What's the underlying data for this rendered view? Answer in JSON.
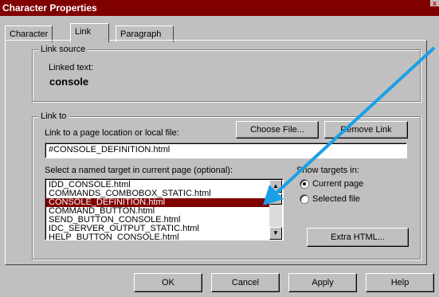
{
  "window": {
    "title": "Character Properties",
    "close_glyph": "x"
  },
  "tabs": [
    {
      "label": "Character"
    },
    {
      "label": "Link"
    },
    {
      "label": "Paragraph"
    }
  ],
  "link_source": {
    "group_label": "Link source",
    "linked_text_label": "Linked text:",
    "linked_text_value": "console"
  },
  "link_to": {
    "group_label": "Link to",
    "location_label": "Link to a page location or local file:",
    "location_value": "#CONSOLE_DEFINITION.html",
    "choose_file": "Choose File...",
    "remove_link": "Remove Link",
    "targets_label": "Select a named target in current page (optional):",
    "targets": [
      "IDD_CONSOLE.html",
      "COMMANDS_COMBOBOX_STATIC.html",
      "CONSOLE_DEFINITION.html",
      "COMMAND_BUTTON.html",
      "SEND_BUTTON_CONSOLE.html",
      "IDC_SERVER_OUTPUT_STATIC.html",
      "HELP_BUTTON_CONSOLE.html"
    ],
    "selected_index": 2,
    "show_targets_label": "Show targets in:",
    "current_page": "Current page",
    "selected_file": "Selected file",
    "extra_html": "Extra HTML..."
  },
  "footer": {
    "ok": "OK",
    "cancel": "Cancel",
    "apply": "Apply",
    "help": "Help"
  },
  "colors": {
    "titlebar": "#800000",
    "selection": "#800000",
    "arrow": "#1aa0e6"
  }
}
